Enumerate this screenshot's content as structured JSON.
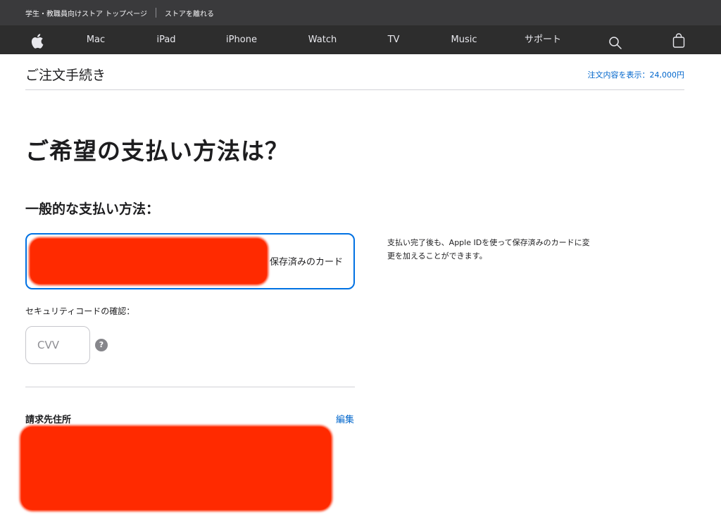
{
  "topbar": {
    "store_home": "学生・教職員向けストア トップページ",
    "leave_store": "ストアを離れる"
  },
  "nav": {
    "items": [
      "Mac",
      "iPad",
      "iPhone",
      "Watch",
      "TV",
      "Music",
      "サポート"
    ]
  },
  "checkout": {
    "title": "ご注文手続き",
    "order_summary": "注文内容を表示：24,000円"
  },
  "payment": {
    "heading": "ご希望の支払い方法は？",
    "section_heading": "一般的な支払い方法：",
    "saved_card_label": "保存済みのカード",
    "side_note": "支払い完了後も、Apple IDを使って保存済みのカードに変更を加えることができます。",
    "cvv_label": "セキュリティコードの確認：",
    "cvv_placeholder": "CVV",
    "help_symbol": "?"
  },
  "billing": {
    "heading": "請求先住所",
    "edit_label": "編集"
  },
  "colors": {
    "accent": "#0071e3",
    "link": "#0066cc",
    "redaction": "#ff2a00"
  }
}
